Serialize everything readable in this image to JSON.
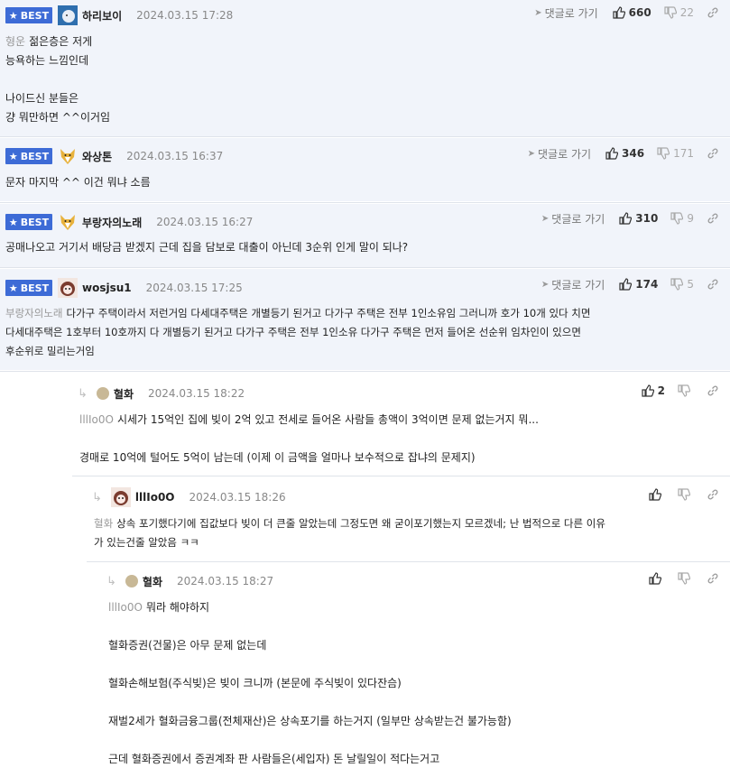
{
  "best_label": "BEST",
  "goto_label": "댓글로 가기",
  "comments": [
    {
      "nick": "하리보이",
      "date": "2024.03.15 17:28",
      "likes": "660",
      "dislikes": "22",
      "mention": "형운",
      "lines": [
        "젊은층은 저게",
        "능욕하는 느낌인데",
        "",
        "나이드신 분들은",
        "걍 뭐만하면 ^^이거임"
      ]
    },
    {
      "nick": "와상톤",
      "date": "2024.03.15 16:37",
      "likes": "346",
      "dislikes": "171",
      "lines": [
        "문자 마지막 ^^ 이건 뭐냐 소름"
      ]
    },
    {
      "nick": "부랑자의노래",
      "date": "2024.03.15 16:27",
      "likes": "310",
      "dislikes": "9",
      "lines": [
        "공매나오고 거기서 배당금 받겠지 근데 집을 담보로 대출이 아닌데 3순위 인게 말이 되나?"
      ]
    },
    {
      "nick": "wosjsu1",
      "date": "2024.03.15 17:25",
      "likes": "174",
      "dislikes": "5",
      "mention": "부랑자의노래",
      "lines": [
        "다가구 주택이라서 저런거임 다세대주택은 개별등기 된거고 다가구 주택은 전부 1인소유임 그러니까 호가 10개 있다 치면",
        "다세대주택은 1호부터 10호까지 다 개별등기 된거고 다가구 주택은 전부 1인소유 다가구 주택은 먼저 들어온 선순위 임차인이 있으면",
        "후순위로 밀리는거임"
      ]
    }
  ],
  "replies": [
    {
      "nick": "혈화",
      "date": "2024.03.15 18:22",
      "likes": "2",
      "mention": "lllIo0O",
      "lines": [
        "시세가 15억인 집에 빚이 2억 있고 전세로 들어온 사람들 총액이 3억이면 문제 없는거지 뭐...",
        "",
        "경매로 10억에 털어도 5억이 남는데 (이제 이 금액을 얼마나 보수적으로 잡냐의 문제지)"
      ]
    },
    {
      "nick": "lllIo0O",
      "date": "2024.03.15 18:26",
      "mention": "혈화",
      "lines": [
        "상속 포기했다기에 집값보다 빚이 더 큰줄 알았는데 그정도면 왜 굳이포기했는지 모르겠네; 난 법적으로 다른 이유",
        "가 있는건줄 알았음 ㅋㅋ"
      ]
    },
    {
      "nick": "혈화",
      "date": "2024.03.15 18:27",
      "mention": "lllIo0O",
      "lines": [
        "뭐라 해야하지",
        "",
        "혈화증권(건물)은 아무 문제 없는데",
        "",
        "혈화손해보험(주식빚)은 빚이 크니까 (본문에 주식빚이 있다잔슴)",
        "",
        "재벌2세가 혈화금융그룹(전체재산)은 상속포기를 하는거지 (일부만 상속받는건 불가능함)",
        "",
        "근데 혈화증권에서 증권계좌 판 사람들은(세입자) 돈 날릴일이 적다는거고"
      ]
    }
  ],
  "colors": {
    "best": "#3d6bd6",
    "best_bg": "#f1f4fa",
    "muted": "#999999"
  }
}
